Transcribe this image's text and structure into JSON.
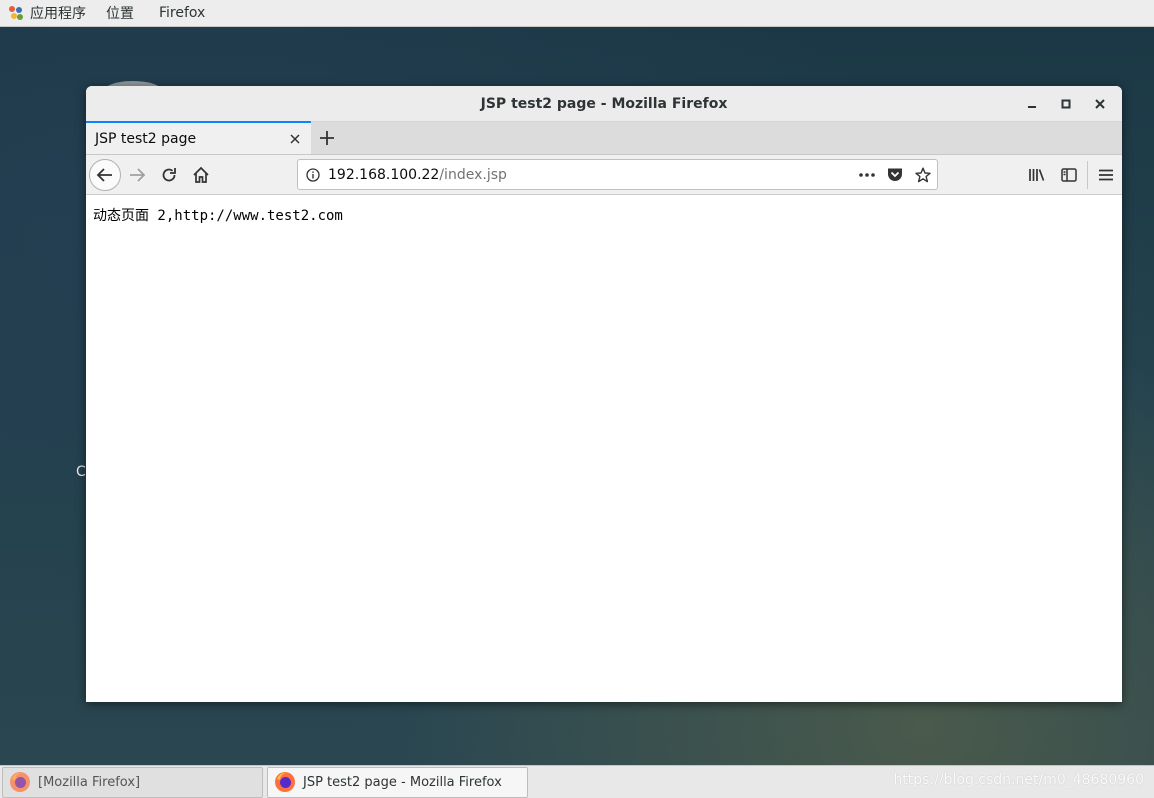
{
  "top_panel": {
    "applications": "应用程序",
    "places": "位置",
    "firefox": "Firefox"
  },
  "desktop": {
    "label": "C"
  },
  "window": {
    "title": "JSP test2 page - Mozilla Firefox",
    "tab_title": "JSP test2 page",
    "url_host": "192.168.100.22",
    "url_path": "/index.jsp",
    "page_content": "动态页面 2,http://www.test2.com"
  },
  "taskbar": {
    "task1": "[Mozilla Firefox]",
    "task2": "JSP test2 page - Mozilla Firefox",
    "watermark": "https://blog.csdn.net/m0_48680960"
  },
  "colors": {
    "tab_accent": "#0a84ff",
    "firefox_orange": "#ff7139",
    "firefox_purple": "#592acb"
  }
}
